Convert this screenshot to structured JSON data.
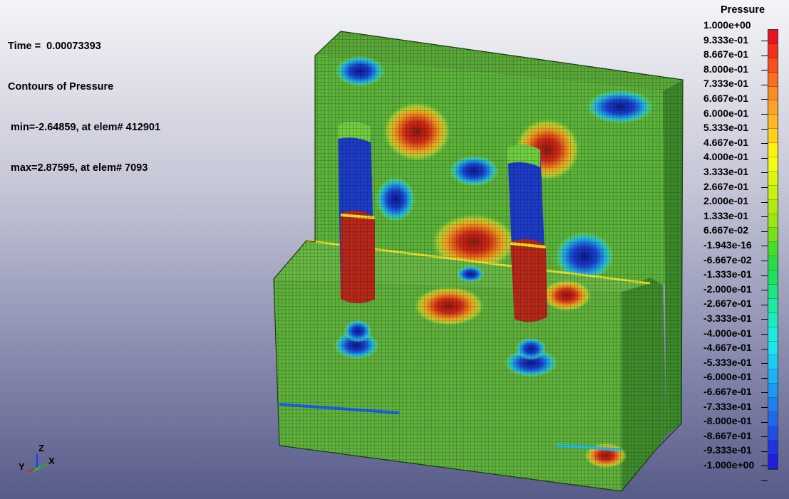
{
  "info": {
    "time_line": "Time =  0.00073393",
    "contour_line": "Contours of Pressure",
    "min_line": " min=-2.64859, at elem# 412901",
    "max_line": " max=2.87595, at elem# 7093"
  },
  "legend": {
    "title": "Pressure",
    "labels": [
      "1.000e+00",
      "9.333e-01",
      "8.667e-01",
      "8.000e-01",
      "7.333e-01",
      "6.667e-01",
      "6.000e-01",
      "5.333e-01",
      "4.667e-01",
      "4.000e-01",
      "3.333e-01",
      "2.667e-01",
      "2.000e-01",
      "1.333e-01",
      "6.667e-02",
      "-1.943e-16",
      "-6.667e-02",
      "-1.333e-01",
      "-2.000e-01",
      "-2.667e-01",
      "-3.333e-01",
      "-4.000e-01",
      "-4.667e-01",
      "-5.333e-01",
      "-6.000e-01",
      "-6.667e-01",
      "-7.333e-01",
      "-8.000e-01",
      "-8.667e-01",
      "-9.333e-01",
      "-1.000e+00"
    ],
    "colors": [
      "#e8141e",
      "#f0321e",
      "#f5501e",
      "#f87020",
      "#fa8c23",
      "#fda226",
      "#ffb823",
      "#ffd11e",
      "#fff014",
      "#f3fc14",
      "#ddf514",
      "#c8f014",
      "#b1ea12",
      "#9ae616",
      "#76e11c",
      "#44de28",
      "#28dc46",
      "#1ee062",
      "#1ee484",
      "#1ee8a3",
      "#1ee9c0",
      "#1eeadc",
      "#1ee4f0",
      "#1ecbf4",
      "#1eb1f5",
      "#1e98f3",
      "#1e80f0",
      "#1e68ed",
      "#1e4ee8",
      "#1e34e5",
      "#1e1ee0"
    ]
  },
  "model": {
    "mesh_label": "Pressure"
  },
  "triad": {
    "z": "Z",
    "y": "Y",
    "x": "X"
  }
}
